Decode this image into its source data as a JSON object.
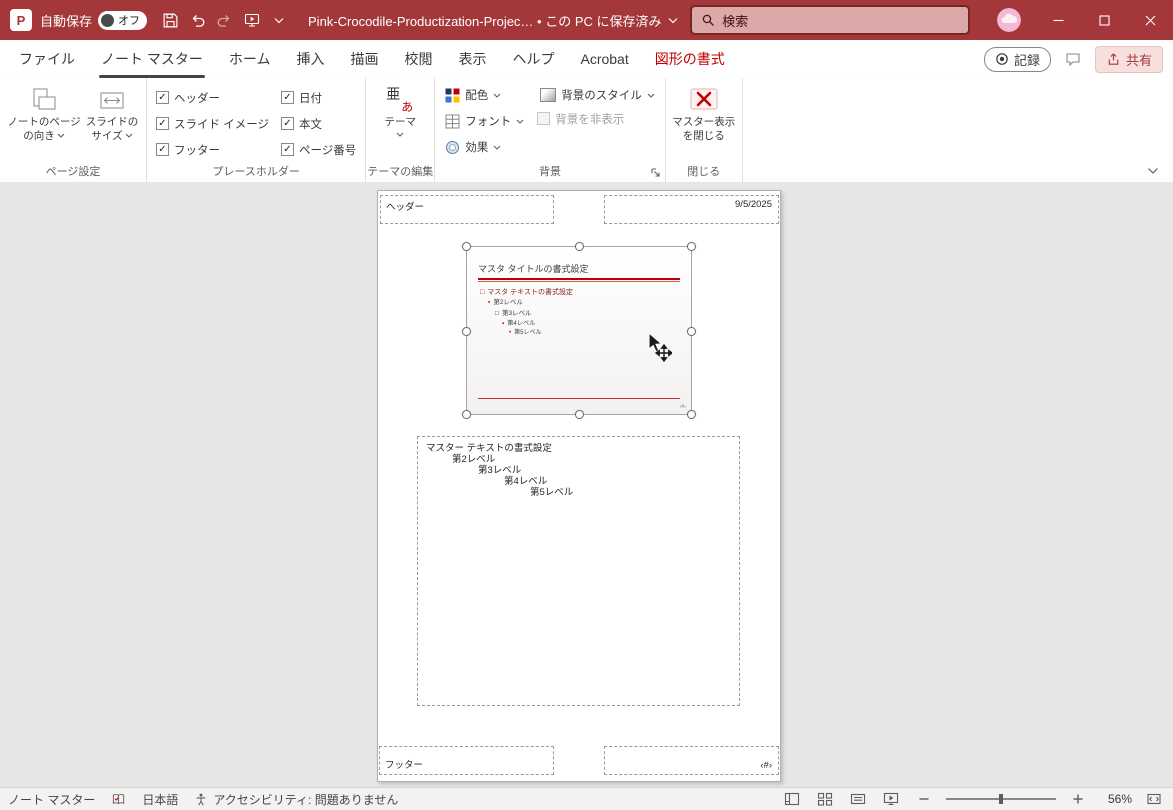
{
  "titlebar": {
    "autosave_label": "自動保存",
    "autosave_state": "オフ",
    "document_title": "Pink-Crocodile-Productization-Projec… • この PC に保存済み",
    "search_placeholder": "検索"
  },
  "tabs": [
    "ファイル",
    "ノート マスター",
    "ホーム",
    "挿入",
    "描画",
    "校閲",
    "表示",
    "ヘルプ",
    "Acrobat",
    "図形の書式"
  ],
  "tabrow_right": {
    "record": "記録",
    "share": "共有"
  },
  "ribbon": {
    "page_setup": {
      "label": "ページ設定",
      "orientation": "ノートのページの向き",
      "slide_size": "スライドのサイズ"
    },
    "placeholders": {
      "label": "プレースホルダー",
      "col1": [
        "ヘッダー",
        "スライド イメージ",
        "フッター"
      ],
      "col2": [
        "日付",
        "本文",
        "ページ番号"
      ]
    },
    "edit_theme": {
      "label": "テーマの編集",
      "theme": "テーマ"
    },
    "background": {
      "label": "背景",
      "colors": "配色",
      "fonts": "フォント",
      "effects": "効果",
      "styles": "背景のスタイル",
      "hide": "背景を非表示"
    },
    "close": {
      "label": "閉じる",
      "button_line1": "マスター表示",
      "button_line2": "を閉じる"
    }
  },
  "notes_page": {
    "header": "ヘッダー",
    "date": "9/5/2025",
    "footer": "フッター",
    "page_number": "‹#›",
    "slide": {
      "title": "マスタ タイトルの書式設定",
      "bullets": [
        "マスタ テキストの書式設定",
        "第2レベル",
        "第3レベル",
        "第4レベル",
        "第5レベル"
      ],
      "slide_number": "‹#›"
    },
    "body": [
      "マスター テキストの書式設定",
      "第2レベル",
      "第3レベル",
      "第4レベル",
      "第5レベル"
    ]
  },
  "statusbar": {
    "view_name": "ノート マスター",
    "language": "日本語",
    "accessibility": "アクセシビリティ: 問題ありません",
    "zoom": "56%"
  },
  "icons": {
    "theme_icon_kanji": "亜",
    "theme_icon_kana": "あ",
    "bullet_glyphs": [
      "□",
      "▪",
      "□",
      "▪",
      "•"
    ]
  },
  "colors": {
    "titlebar": "#A4373A",
    "accent": "#C00000",
    "contextual_tab": "#C00000"
  }
}
